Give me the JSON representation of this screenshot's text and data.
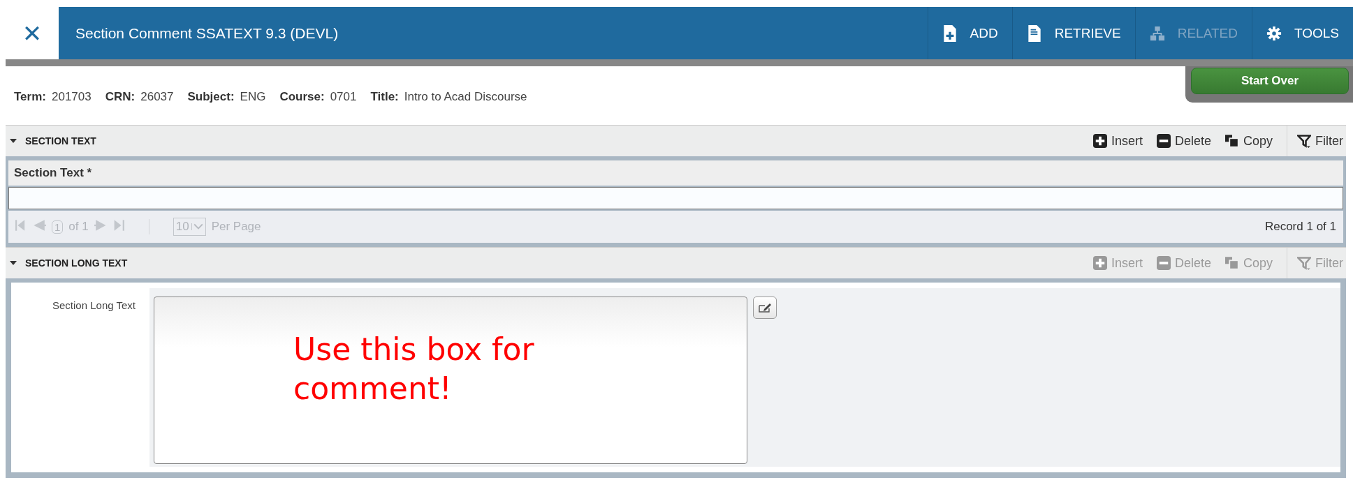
{
  "header": {
    "close": "✕",
    "title": "Section Comment SSATEXT 9.3 (DEVL)",
    "actions": [
      {
        "kind": "add",
        "label": "ADD",
        "disabled": false
      },
      {
        "kind": "retrieve",
        "label": "RETRIEVE",
        "disabled": false
      },
      {
        "kind": "related",
        "label": "RELATED",
        "disabled": true
      },
      {
        "kind": "tools",
        "label": "TOOLS",
        "disabled": false
      }
    ]
  },
  "start_over": "Start Over",
  "key_info": [
    {
      "label": "Term:",
      "value": "201703"
    },
    {
      "label": "CRN:",
      "value": "26037"
    },
    {
      "label": "Subject:",
      "value": "ENG"
    },
    {
      "label": "Course:",
      "value": "0701"
    },
    {
      "label": "Title:",
      "value": "Intro to Acad Discourse"
    }
  ],
  "sections": [
    {
      "kind": "grid",
      "title": "SECTION TEXT",
      "expanded": true,
      "tools": [
        {
          "kind": "insert",
          "label": "Insert",
          "disabled": false
        },
        {
          "kind": "delete",
          "label": "Delete",
          "disabled": false
        },
        {
          "kind": "copy",
          "label": "Copy",
          "disabled": false
        },
        {
          "kind": "filter",
          "label": "Filter",
          "disabled": false
        }
      ],
      "column": "Section Text *",
      "pager": {
        "page": "1",
        "of": "of 1",
        "per_page": "10",
        "per_page_label": "Per Page",
        "record": "Record 1 of 1"
      }
    },
    {
      "kind": "form",
      "title": "SECTION LONG TEXT",
      "expanded": true,
      "tools": [
        {
          "kind": "insert",
          "label": "Insert",
          "disabled": true
        },
        {
          "kind": "delete",
          "label": "Delete",
          "disabled": true
        },
        {
          "kind": "copy",
          "label": "Copy",
          "disabled": true
        },
        {
          "kind": "filter",
          "label": "Filter",
          "disabled": true
        }
      ],
      "field_label": "Section Long Text",
      "annotation": "Use this box for comment!"
    }
  ]
}
